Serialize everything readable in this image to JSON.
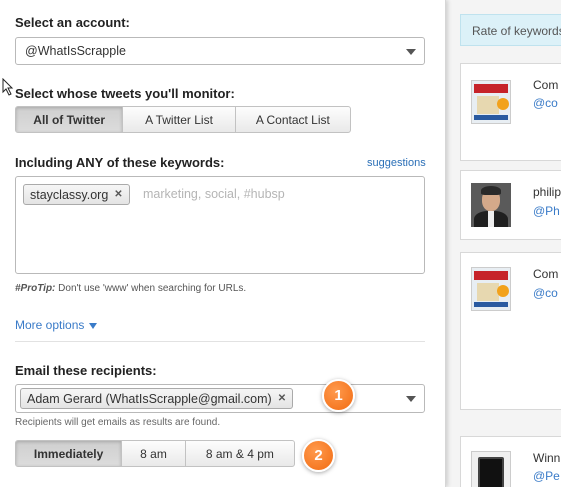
{
  "account": {
    "label": "Select an account:",
    "selected": "@WhatIsScrapple"
  },
  "monitor": {
    "label": "Select whose tweets you'll monitor:",
    "options": [
      "All of Twitter",
      "A Twitter List",
      "A Contact List"
    ]
  },
  "keywords": {
    "label": "Including ANY of these keywords:",
    "suggestions": "suggestions",
    "tag": "stayclassy.org",
    "placeholder": "marketing, social, #hubsp",
    "protip_prefix": "#ProTip:",
    "protip_text": " Don't use 'www' when searching for URLs."
  },
  "more_options": "More options",
  "recipients": {
    "label": "Email these recipients:",
    "tag": "Adam Gerard (WhatIsScrapple@gmail.com)",
    "helper": "Recipients will get emails as results are found."
  },
  "frequency": {
    "options": [
      "Immediately",
      "8 am",
      "8 am & 4 pm"
    ]
  },
  "badges": [
    "1",
    "2"
  ],
  "sidebar": {
    "rate_text": "Rate of keywords",
    "tweets": [
      {
        "name": "Com",
        "handle": "@co"
      },
      {
        "name": "philip",
        "handle": "@Ph"
      },
      {
        "name": "Com",
        "handle": "@co"
      },
      {
        "name": "Winn",
        "handle": "@Pe"
      }
    ]
  },
  "colors": {
    "accent_link": "#3a7bc8",
    "badge": "#f26b12",
    "rate_bg": "#dcf1f8"
  }
}
